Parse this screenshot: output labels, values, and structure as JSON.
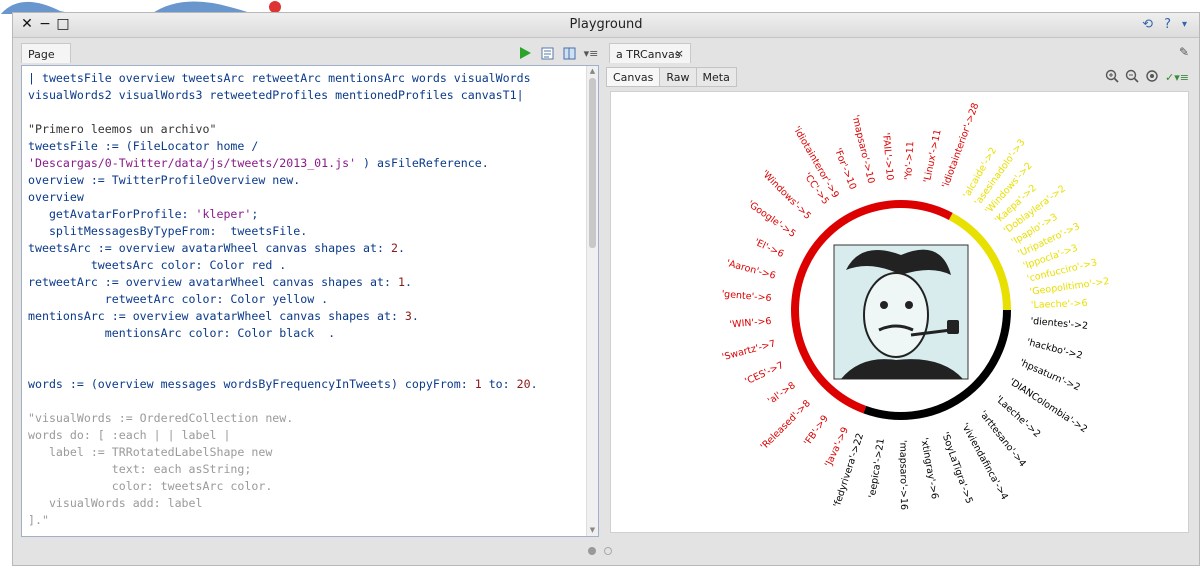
{
  "window": {
    "title": "Playground",
    "left_tab": "Page",
    "right_tab": "a TRCanvas",
    "close_char": "×"
  },
  "canvas_tabs": [
    "Canvas",
    "Raw",
    "Meta"
  ],
  "code_lines": [
    "| tweetsFile overview tweetsArc retweetArc mentionsArc words visualWords",
    "visualWords2 visualWords3 retweetedProfiles mentionedProfiles canvasT1|",
    "",
    "\"Primero leemos un archivo\"",
    "tweetsFile := (FileLocator home /",
    "'Descargas/0-Twitter/data/js/tweets/2013_01.js' ) asFileReference.",
    "overview := TwitterProfileOverview new.",
    "overview",
    "   getAvatarForProfile: 'kleper';",
    "   splitMessagesByTypeFrom:  tweetsFile.",
    "tweetsArc := overview avatarWheel canvas shapes at: 2.",
    "         tweetsArc color: Color red .",
    "retweetArc := overview avatarWheel canvas shapes at: 1.",
    "           retweetArc color: Color yellow .",
    "mentionsArc := overview avatarWheel canvas shapes at: 3.",
    "           mentionsArc color: Color black  .",
    "",
    "",
    "words := (overview messages wordsByFrequencyInTweets) copyFrom: 1 to: 20.",
    "",
    "\"visualWords := OrderedCollection new.",
    "words do: [ :each | | label |",
    "   label := TRRotatedLabelShape new",
    "            text: each asString;",
    "            color: tweetsArc color.",
    "   visualWords add: label",
    "].\""
  ],
  "wheel": {
    "colors": {
      "tweets": "#dd0000",
      "retweets": "#e8e000",
      "mentions": "#000000"
    },
    "red_labels": [
      "'idiotainteror'->9",
      "'For'->10",
      "'mapsaro'->10",
      "'FAIL'->10",
      "'Yo'->11",
      "'Linux'->11",
      "'idiotainterior'->28",
      "'Java'->9",
      "'FB'->9",
      "'Released'->8",
      "'al'->8",
      "'CES'->7",
      "'Swartz'->7",
      "'WIN'->6",
      "'gente'->6",
      "'Aaron'->6",
      "'El'->6",
      "'Google'->5",
      "'Windows'->5",
      "'CC'->5"
    ],
    "yellow_labels": [
      "'alcaide'->2",
      "'asesinadolo'->3",
      "'Windows'->2",
      "'Kaepa'->2",
      "'Doblaylera'->2",
      "'Ipaplo'->3",
      "'Uripatero'->3",
      "'Ippocla'->3",
      "'confucciro'->3",
      "'Geopolitimo'->2",
      "'Laeche'->6"
    ],
    "black_labels": [
      "'dientes'->2",
      "'hackbo'->2",
      "'hpsaturn'->2",
      "'DIANColombia'->2",
      "'Laeche'->2",
      "'arttesano'->4",
      "'viviendafinca'->4",
      "'SoyLaTigra'->5",
      "'xtingray'->6",
      "'mapsaro'->16",
      "'eepica'->21",
      "'fedyrivera'->22"
    ]
  }
}
